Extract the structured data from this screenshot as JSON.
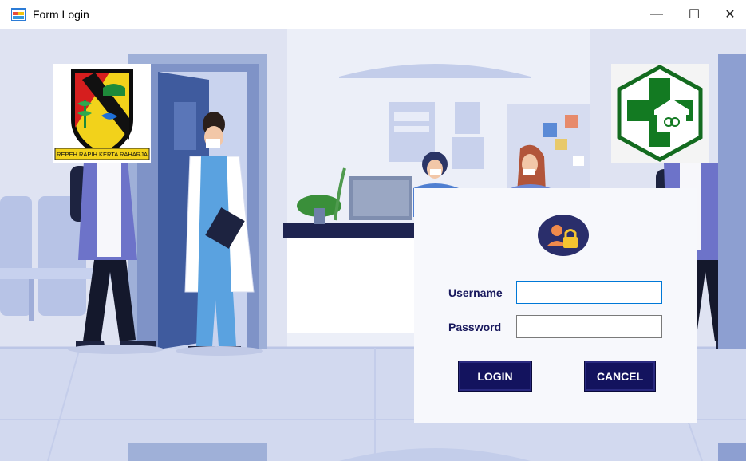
{
  "window": {
    "title": "Form Login",
    "minimize_glyph": "—",
    "maximize_glyph": "☐",
    "close_glyph": "✕"
  },
  "logos": {
    "left": {
      "name": "regency-coat-of-arms",
      "motto": "REPEH RAPIH KERTA RAHARJA"
    },
    "right": {
      "name": "puskesmas-green-cross-logo"
    }
  },
  "login": {
    "username_label": "Username",
    "password_label": "Password",
    "username_value": "",
    "password_value": "",
    "login_button": "LOGIN",
    "cancel_button": "CANCEL"
  },
  "colors": {
    "accent": "#13135e",
    "panel": "#f7f8fc",
    "focus": "#0078d7",
    "logo_green": "#1a6b1a"
  }
}
